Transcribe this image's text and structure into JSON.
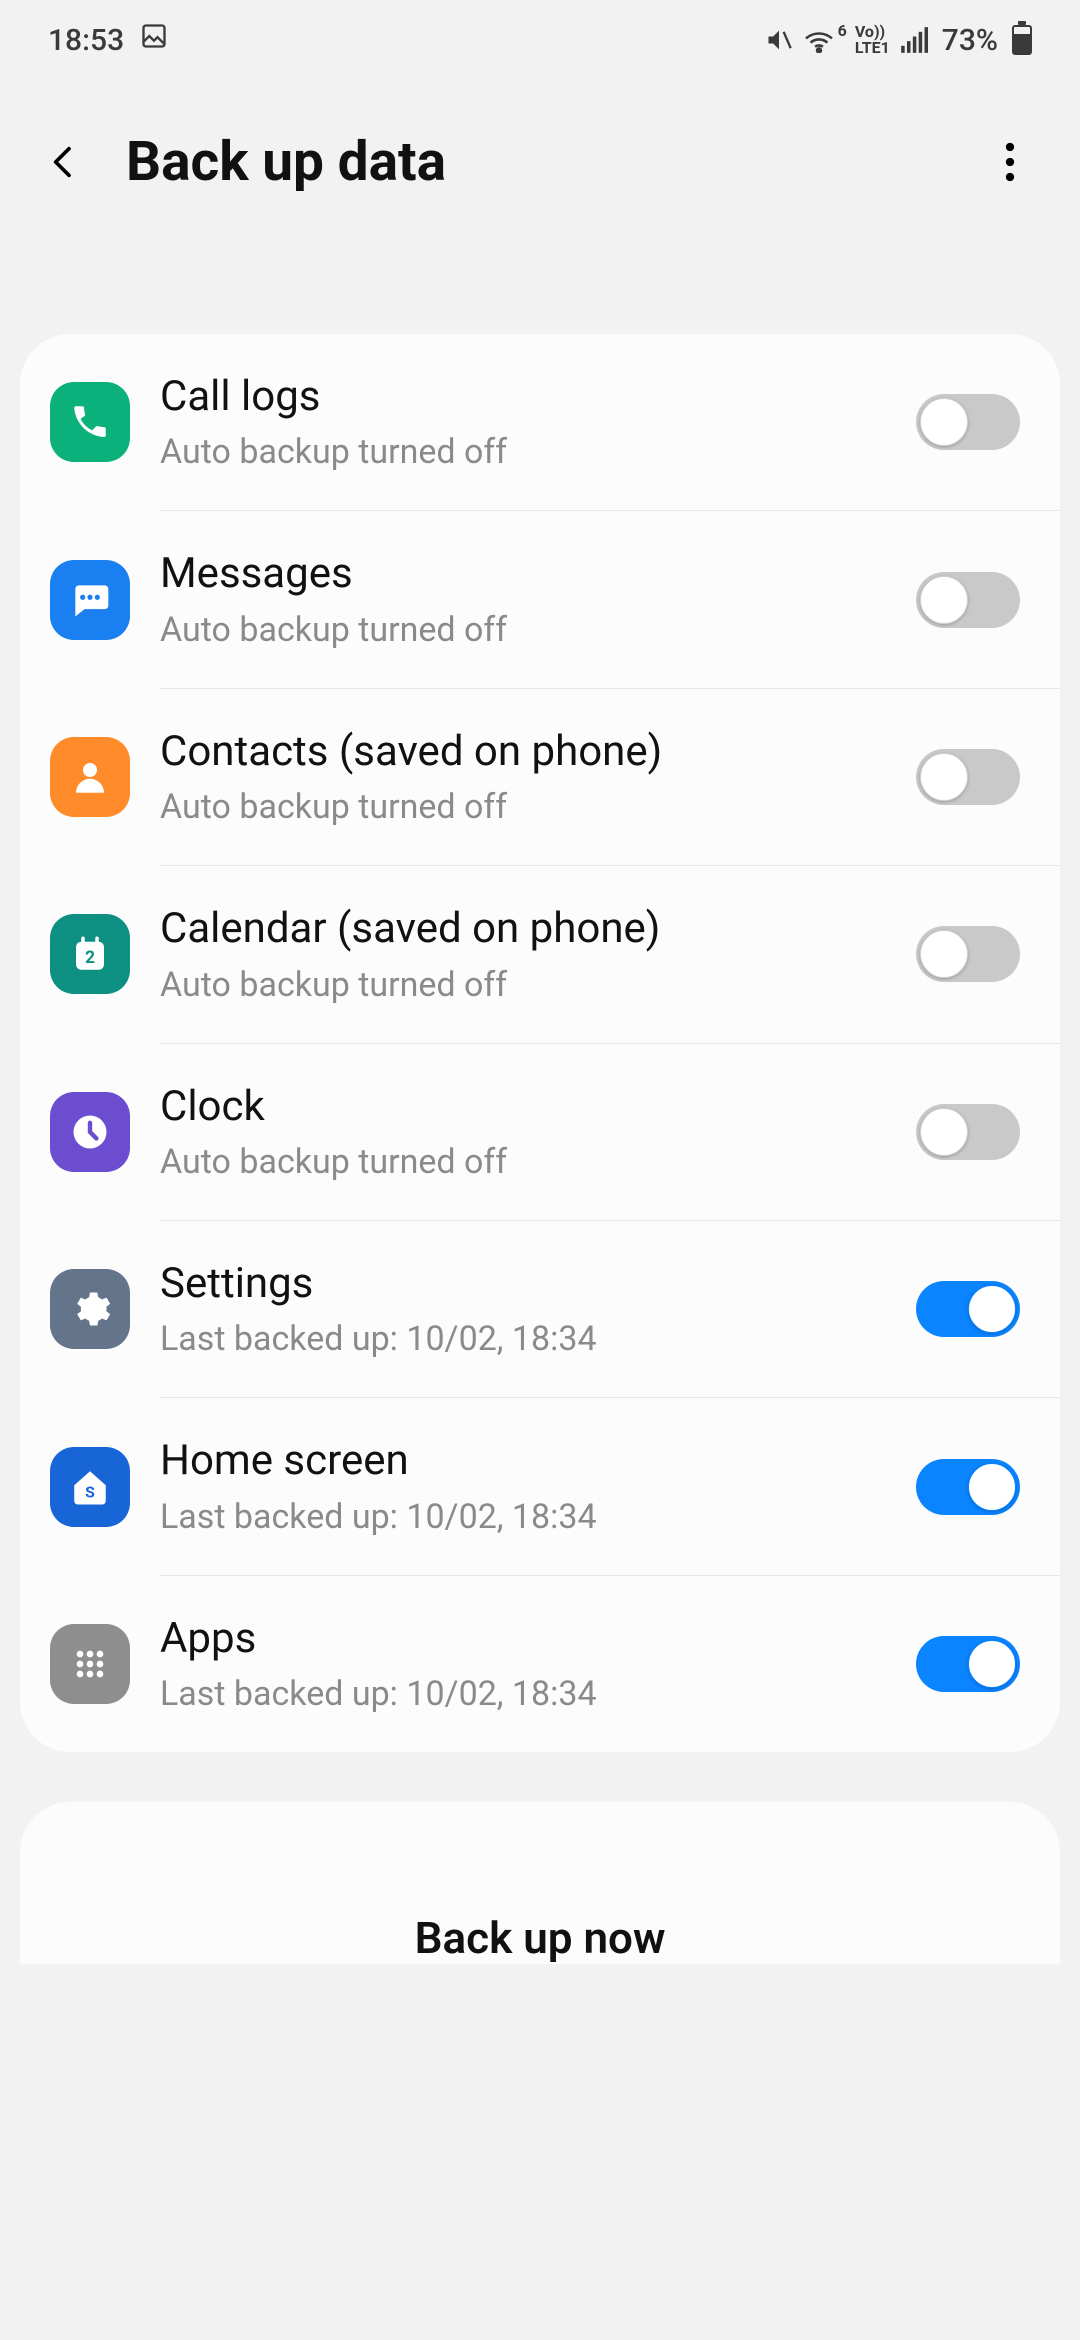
{
  "status": {
    "time": "18:53",
    "battery_pct": "73%",
    "net_label_top": "Vo))",
    "net_label_bottom": "LTE1",
    "wifi_level": "6"
  },
  "header": {
    "back_label": "Back",
    "title": "Back up data",
    "more_label": "More options"
  },
  "items": [
    {
      "icon": "phone-icon",
      "icon_class": "ic-call",
      "title": "Call logs",
      "sub": "Auto backup turned off",
      "on": false
    },
    {
      "icon": "chat-icon",
      "icon_class": "ic-messages",
      "title": "Messages",
      "sub": "Auto backup turned off",
      "on": false
    },
    {
      "icon": "person-icon",
      "icon_class": "ic-contacts",
      "title": "Contacts (saved on phone)",
      "sub": "Auto backup turned off",
      "on": false
    },
    {
      "icon": "calendar-icon",
      "icon_class": "ic-calendar",
      "title": "Calendar (saved on phone)",
      "sub": "Auto backup turned off",
      "on": false
    },
    {
      "icon": "clock-icon",
      "icon_class": "ic-clock",
      "title": "Clock",
      "sub": "Auto backup turned off",
      "on": false
    },
    {
      "icon": "gear-icon",
      "icon_class": "ic-settings",
      "title": "Settings",
      "sub": "Last backed up: 10/02, 18:34",
      "on": true
    },
    {
      "icon": "home-icon",
      "icon_class": "ic-home",
      "title": "Home screen",
      "sub": "Last backed up: 10/02, 18:34",
      "on": true
    },
    {
      "icon": "apps-icon",
      "icon_class": "ic-apps",
      "title": "Apps",
      "sub": "Last backed up: 10/02, 18:34",
      "on": true
    }
  ],
  "primary_action": "Back up now"
}
